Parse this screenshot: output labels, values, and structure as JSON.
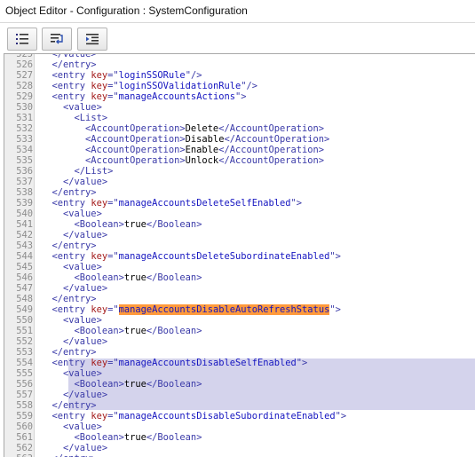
{
  "window": {
    "title": "Object Editor - Configuration : SystemConfiguration"
  },
  "toolbar": {
    "buttons": [
      {
        "name": "format-lines-button",
        "icon": "numbered-list-icon"
      },
      {
        "name": "word-wrap-button",
        "icon": "wrap-text-icon"
      },
      {
        "name": "indent-button",
        "icon": "indent-icon"
      }
    ]
  },
  "editor": {
    "highlight_color": "#ff9a3c",
    "selection_color": "#d4d3ec",
    "lines": [
      {
        "n": "525",
        "i": 1,
        "s": [
          {
            "t": "</value>",
            "c": "tg"
          }
        ]
      },
      {
        "n": "526",
        "i": 1,
        "s": [
          {
            "t": "</entry>",
            "c": "tg"
          }
        ]
      },
      {
        "n": "527",
        "i": 1,
        "s": [
          {
            "t": "<entry ",
            "c": "tg"
          },
          {
            "t": "key",
            "c": "at"
          },
          {
            "t": "=\"",
            "c": "tg"
          },
          {
            "t": "loginSSORule",
            "c": "av"
          },
          {
            "t": "\"/>",
            "c": "tg"
          }
        ]
      },
      {
        "n": "528",
        "i": 1,
        "s": [
          {
            "t": "<entry ",
            "c": "tg"
          },
          {
            "t": "key",
            "c": "at"
          },
          {
            "t": "=\"",
            "c": "tg"
          },
          {
            "t": "loginSSOValidationRule",
            "c": "av"
          },
          {
            "t": "\"/>",
            "c": "tg"
          }
        ]
      },
      {
        "n": "529",
        "i": 1,
        "s": [
          {
            "t": "<entry ",
            "c": "tg"
          },
          {
            "t": "key",
            "c": "at"
          },
          {
            "t": "=\"",
            "c": "tg"
          },
          {
            "t": "manageAccountsActions",
            "c": "av"
          },
          {
            "t": "\">",
            "c": "tg"
          }
        ]
      },
      {
        "n": "530",
        "i": 2,
        "s": [
          {
            "t": "<value>",
            "c": "tg"
          }
        ]
      },
      {
        "n": "531",
        "i": 3,
        "s": [
          {
            "t": "<List>",
            "c": "tg"
          }
        ]
      },
      {
        "n": "532",
        "i": 4,
        "s": [
          {
            "t": "<AccountOperation>",
            "c": "tg"
          },
          {
            "t": "Delete",
            "c": "tx"
          },
          {
            "t": "</AccountOperation>",
            "c": "tg"
          }
        ]
      },
      {
        "n": "533",
        "i": 4,
        "s": [
          {
            "t": "<AccountOperation>",
            "c": "tg"
          },
          {
            "t": "Disable",
            "c": "tx"
          },
          {
            "t": "</AccountOperation>",
            "c": "tg"
          }
        ]
      },
      {
        "n": "534",
        "i": 4,
        "s": [
          {
            "t": "<AccountOperation>",
            "c": "tg"
          },
          {
            "t": "Enable",
            "c": "tx"
          },
          {
            "t": "</AccountOperation>",
            "c": "tg"
          }
        ]
      },
      {
        "n": "535",
        "i": 4,
        "s": [
          {
            "t": "<AccountOperation>",
            "c": "tg"
          },
          {
            "t": "Unlock",
            "c": "tx"
          },
          {
            "t": "</AccountOperation>",
            "c": "tg"
          }
        ]
      },
      {
        "n": "536",
        "i": 3,
        "s": [
          {
            "t": "</List>",
            "c": "tg"
          }
        ]
      },
      {
        "n": "537",
        "i": 2,
        "s": [
          {
            "t": "</value>",
            "c": "tg"
          }
        ]
      },
      {
        "n": "538",
        "i": 1,
        "s": [
          {
            "t": "</entry>",
            "c": "tg"
          }
        ]
      },
      {
        "n": "539",
        "i": 1,
        "s": [
          {
            "t": "<entry ",
            "c": "tg"
          },
          {
            "t": "key",
            "c": "at"
          },
          {
            "t": "=\"",
            "c": "tg"
          },
          {
            "t": "manageAccountsDeleteSelfEnabled",
            "c": "av"
          },
          {
            "t": "\">",
            "c": "tg"
          }
        ]
      },
      {
        "n": "540",
        "i": 2,
        "s": [
          {
            "t": "<value>",
            "c": "tg"
          }
        ]
      },
      {
        "n": "541",
        "i": 3,
        "s": [
          {
            "t": "<Boolean>",
            "c": "tg"
          },
          {
            "t": "true",
            "c": "tx"
          },
          {
            "t": "</Boolean>",
            "c": "tg"
          }
        ]
      },
      {
        "n": "542",
        "i": 2,
        "s": [
          {
            "t": "</value>",
            "c": "tg"
          }
        ]
      },
      {
        "n": "543",
        "i": 1,
        "s": [
          {
            "t": "</entry>",
            "c": "tg"
          }
        ]
      },
      {
        "n": "544",
        "i": 1,
        "s": [
          {
            "t": "<entry ",
            "c": "tg"
          },
          {
            "t": "key",
            "c": "at"
          },
          {
            "t": "=\"",
            "c": "tg"
          },
          {
            "t": "manageAccountsDeleteSubordinateEnabled",
            "c": "av"
          },
          {
            "t": "\">",
            "c": "tg"
          }
        ]
      },
      {
        "n": "545",
        "i": 2,
        "s": [
          {
            "t": "<value>",
            "c": "tg"
          }
        ]
      },
      {
        "n": "546",
        "i": 3,
        "s": [
          {
            "t": "<Boolean>",
            "c": "tg"
          },
          {
            "t": "true",
            "c": "tx"
          },
          {
            "t": "</Boolean>",
            "c": "tg"
          }
        ]
      },
      {
        "n": "547",
        "i": 2,
        "s": [
          {
            "t": "</value>",
            "c": "tg"
          }
        ]
      },
      {
        "n": "548",
        "i": 1,
        "s": [
          {
            "t": "</entry>",
            "c": "tg"
          }
        ]
      },
      {
        "n": "549",
        "i": 1,
        "s": [
          {
            "t": "<entry ",
            "c": "tg"
          },
          {
            "t": "key",
            "c": "at"
          },
          {
            "t": "=\"",
            "c": "tg"
          },
          {
            "t": "manageAccountsDisableAutoRefreshStatus",
            "c": "av",
            "h": true
          },
          {
            "t": "\">",
            "c": "tg"
          }
        ]
      },
      {
        "n": "550",
        "i": 2,
        "s": [
          {
            "t": "<value>",
            "c": "tg"
          }
        ]
      },
      {
        "n": "551",
        "i": 3,
        "s": [
          {
            "t": "<Boolean>",
            "c": "tg"
          },
          {
            "t": "true",
            "c": "tx"
          },
          {
            "t": "</Boolean>",
            "c": "tg"
          }
        ]
      },
      {
        "n": "552",
        "i": 2,
        "s": [
          {
            "t": "</value>",
            "c": "tg"
          }
        ]
      },
      {
        "n": "553",
        "i": 1,
        "s": [
          {
            "t": "</entry>",
            "c": "tg"
          }
        ]
      },
      {
        "n": "554",
        "i": 1,
        "s": [
          {
            "t": "<entry ",
            "c": "tg"
          },
          {
            "t": "key",
            "c": "at"
          },
          {
            "t": "=\"",
            "c": "tg"
          },
          {
            "t": "manageAccountsDisableSelfEnabled",
            "c": "av"
          },
          {
            "t": "\">",
            "c": "tg"
          }
        ]
      },
      {
        "n": "555",
        "i": 2,
        "s": [
          {
            "t": "<value>",
            "c": "tg"
          }
        ]
      },
      {
        "n": "556",
        "i": 3,
        "s": [
          {
            "t": "<Boolean>",
            "c": "tg"
          },
          {
            "t": "true",
            "c": "tx"
          },
          {
            "t": "</Boolean>",
            "c": "tg"
          }
        ]
      },
      {
        "n": "557",
        "i": 2,
        "s": [
          {
            "t": "</value>",
            "c": "tg"
          }
        ]
      },
      {
        "n": "558",
        "i": 1,
        "s": [
          {
            "t": "</entry>",
            "c": "tg"
          }
        ]
      },
      {
        "n": "559",
        "i": 1,
        "s": [
          {
            "t": "<entry ",
            "c": "tg"
          },
          {
            "t": "key",
            "c": "at"
          },
          {
            "t": "=\"",
            "c": "tg"
          },
          {
            "t": "manageAccountsDisableSubordinateEnabled",
            "c": "av"
          },
          {
            "t": "\">",
            "c": "tg"
          }
        ]
      },
      {
        "n": "560",
        "i": 2,
        "s": [
          {
            "t": "<value>",
            "c": "tg"
          }
        ]
      },
      {
        "n": "561",
        "i": 3,
        "s": [
          {
            "t": "<Boolean>",
            "c": "tg"
          },
          {
            "t": "true",
            "c": "tx"
          },
          {
            "t": "</Boolean>",
            "c": "tg"
          }
        ]
      },
      {
        "n": "562",
        "i": 2,
        "s": [
          {
            "t": "</value>",
            "c": "tg"
          }
        ]
      },
      {
        "n": "563",
        "i": 1,
        "s": [
          {
            "t": "</entry>",
            "c": "tg"
          }
        ]
      }
    ]
  }
}
